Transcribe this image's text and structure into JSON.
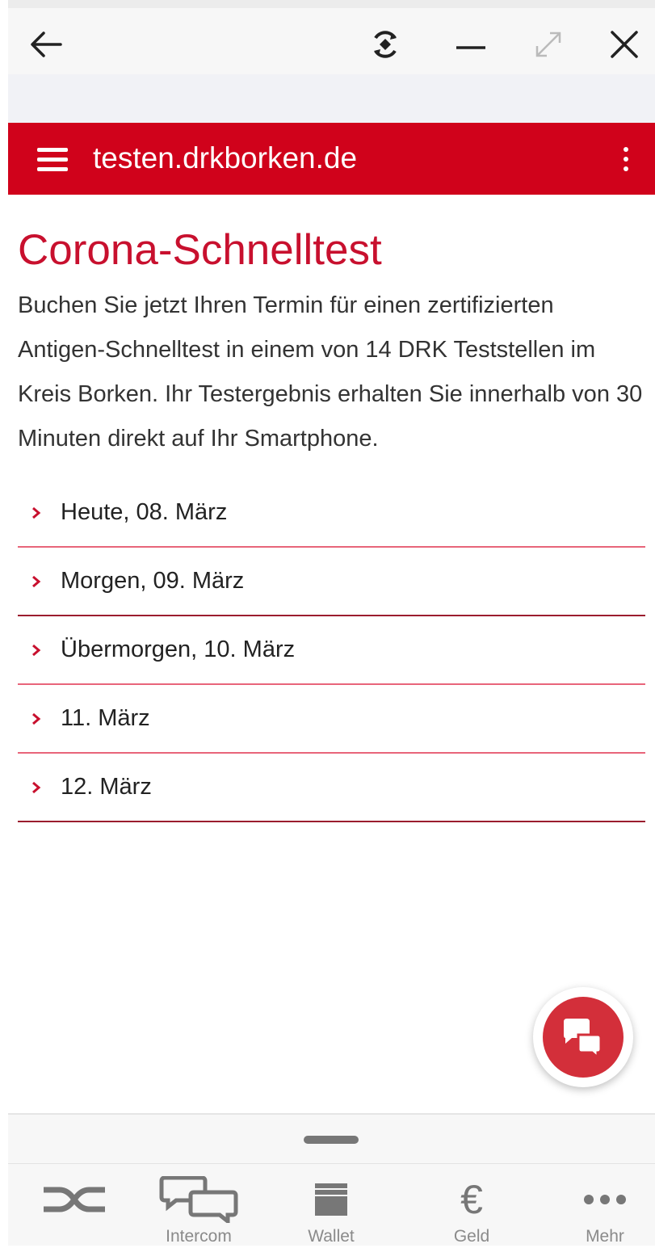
{
  "browser": {
    "back_icon": "arrow-left-icon",
    "sync_icon": "rotate-icon",
    "minimize_icon": "minus-icon",
    "expand_icon": "expand-icon",
    "close_icon": "close-icon"
  },
  "appbar": {
    "url": "testen.drkborken.de",
    "menu_icon": "hamburger-icon",
    "more_icon": "kebab-icon",
    "color": "#d0021b"
  },
  "main": {
    "title": "Corona-Schnelltest",
    "intro": "Buchen Sie jetzt Ihren Termin für einen zertifizierten Antigen-Schnelltest in einem von 14 DRK Teststellen im Kreis Borken. Ihr Testergebnis erhalten Sie innerhalb von 30 Minuten direkt auf Ihr Smartphone.",
    "dates": [
      {
        "label": "Heute, 08. März"
      },
      {
        "label": "Morgen, 09. März"
      },
      {
        "label": "Übermorgen, 10. März"
      },
      {
        "label": "11. März"
      },
      {
        "label": "12. März"
      }
    ],
    "accent": "#c8102e"
  },
  "fab": {
    "icon": "chat-icon",
    "color": "#d32f3a"
  },
  "tabbar": {
    "items": [
      {
        "icon": "connect-icon",
        "label": ""
      },
      {
        "icon": "intercom-icon",
        "label": "Intercom"
      },
      {
        "icon": "wallet-icon",
        "label": "Wallet"
      },
      {
        "icon": "euro-icon",
        "label": "Geld"
      },
      {
        "icon": "more-dots-icon",
        "label": "Mehr"
      }
    ]
  }
}
